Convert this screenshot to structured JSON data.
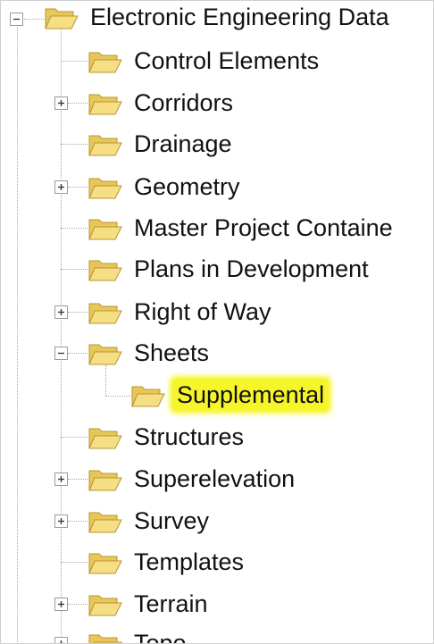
{
  "tree": {
    "root": {
      "label": "Electronic Engineering Data",
      "expanded": true
    },
    "items": [
      {
        "label": "Control Elements",
        "has_children": false
      },
      {
        "label": "Corridors",
        "has_children": true,
        "expanded": false
      },
      {
        "label": "Drainage",
        "has_children": false
      },
      {
        "label": "Geometry",
        "has_children": true,
        "expanded": false
      },
      {
        "label": "Master Project Containe",
        "has_children": false
      },
      {
        "label": "Plans in Development",
        "has_children": false
      },
      {
        "label": "Right of Way",
        "has_children": true,
        "expanded": false
      },
      {
        "label": "Sheets",
        "has_children": true,
        "expanded": true,
        "children": [
          {
            "label": "Supplemental",
            "highlighted": true
          }
        ]
      },
      {
        "label": "Structures",
        "has_children": false
      },
      {
        "label": "Superelevation",
        "has_children": true,
        "expanded": false
      },
      {
        "label": "Survey",
        "has_children": true,
        "expanded": false
      },
      {
        "label": "Templates",
        "has_children": false
      },
      {
        "label": "Terrain",
        "has_children": true,
        "expanded": false
      },
      {
        "label": "Topo",
        "has_children": true,
        "expanded": false
      }
    ]
  },
  "colors": {
    "highlight": "#f5f52a",
    "folder": "#f2d46b",
    "line": "#a9a9a9"
  }
}
